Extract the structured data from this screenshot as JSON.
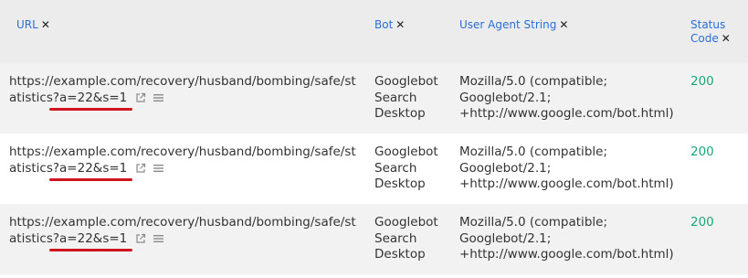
{
  "columns": {
    "url": "URL",
    "bot": "Bot",
    "user_agent": "User Agent String",
    "status_code": "Status Code"
  },
  "rows": [
    {
      "url_base": "https://example.com/recovery/husband/bombing/safe/statistics",
      "url_query": "?a=22&s=1",
      "bot": "Googlebot Search Desktop",
      "user_agent": "Mozilla/5.0 (compatible; Googlebot/2.1; +http://www.google.com/bot.html)",
      "status": "200"
    },
    {
      "url_base": "https://example.com/recovery/husband/bombing/safe/statistics",
      "url_query": "?a=22&s=1",
      "bot": "Googlebot Search Desktop",
      "user_agent": "Mozilla/5.0 (compatible; Googlebot/2.1; +http://www.google.com/bot.html)",
      "status": "200"
    },
    {
      "url_base": "https://example.com/recovery/husband/bombing/safe/statistics",
      "url_query": "?a=22&s=1",
      "bot": "Googlebot Search Desktop",
      "user_agent": "Mozilla/5.0 (compatible; Googlebot/2.1; +http://www.google.com/bot.html)",
      "status": "200"
    }
  ],
  "icons": {
    "open": "external-link-icon",
    "menu": "menu-lines-icon",
    "remove": "close-icon"
  },
  "colors": {
    "header_text": "#2b6fd6",
    "status_ok": "#1aa87a",
    "highlight": "#d0141f"
  }
}
